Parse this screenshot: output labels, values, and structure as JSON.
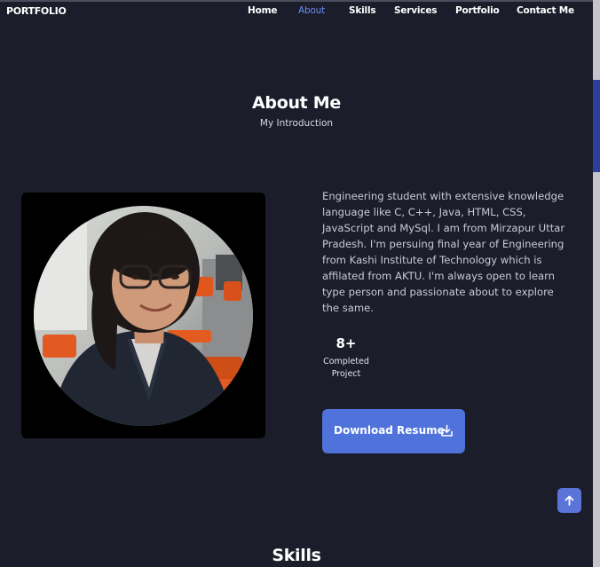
{
  "header": {
    "logo": "PORTFOLIO",
    "nav": [
      {
        "label": "Home",
        "active": false
      },
      {
        "label": "About",
        "active": true
      },
      {
        "label": "Skills",
        "active": false
      },
      {
        "label": "Services",
        "active": false
      },
      {
        "label": "Portfolio",
        "active": false
      },
      {
        "label": "Contact Me",
        "active": false
      }
    ]
  },
  "about": {
    "title": "About Me",
    "subtitle": "My Introduction",
    "bio": "Engineering student with extensive knowledge language like C, C++, Java, HTML, CSS, JavaScript and MySql. I am from Mirzapur Uttar Pradesh. I'm persuing final year of Engineering from Kashi Institute of Technology which is affilated from AKTU. I'm always open to learn type person and passionate about to explore the same.",
    "stat": {
      "value": "8+",
      "label": "Completed Project"
    },
    "download_button": {
      "label": "Download Resume",
      "icon": "download-icon"
    }
  },
  "skills": {
    "title": "Skills"
  },
  "scroll_top": {
    "icon": "arrow-up-icon"
  },
  "colors": {
    "background": "#1b1d2a",
    "accent": "#4f73da",
    "nav_active": "#6b8cf5",
    "text": "#ffffff"
  }
}
